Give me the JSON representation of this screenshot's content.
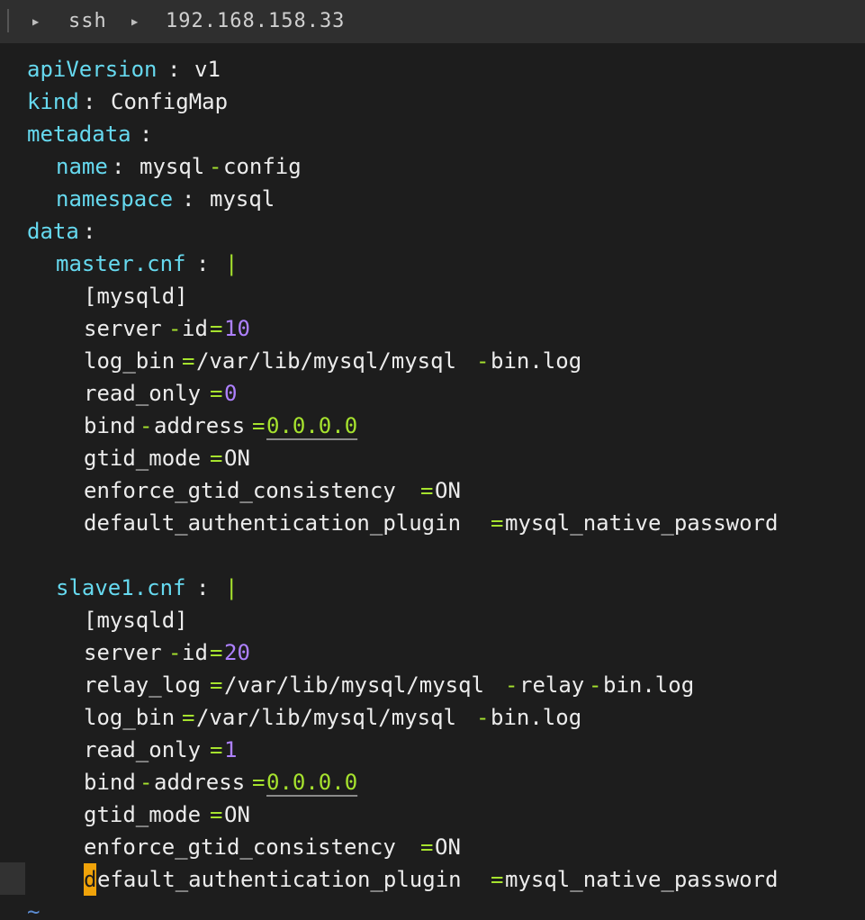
{
  "tabbar": {
    "segments": [
      "ssh",
      "192.168.158.33"
    ]
  },
  "editor": {
    "lines": {
      "l1_key": "apiVersion",
      "l1_sep": ": ",
      "l1_val": "v1",
      "l2_key": "kind",
      "l2_sep": ": ",
      "l2_val": "ConfigMap",
      "l3_key": "metadata",
      "l3_sep": ":",
      "l4_key": "name",
      "l4_sep": ": ",
      "l4_val_a": "mysql",
      "l4_dash": "-",
      "l4_val_b": "config",
      "l5_key": "namespace",
      "l5_sep": ": ",
      "l5_val": "mysql",
      "l6_key": "data",
      "l6_sep": ":",
      "l7_key": "master.cnf",
      "l7_sep": ": ",
      "l7_pipe": "|",
      "l8": "[mysqld]",
      "l9_a": "server",
      "l9_dash": "-",
      "l9_b": "id",
      "l9_eq": "=",
      "l9_num": "10",
      "l10_a": "log_bin",
      "l10_eq": "=",
      "l10_b": "/var/lib/mysql/mysql",
      "l10_dash": "-",
      "l10_c": "bin.log",
      "l11_a": "read_only",
      "l11_eq": "=",
      "l11_num": "0",
      "l12_a": "bind",
      "l12_dash": "-",
      "l12_b": "address",
      "l12_eq": "=",
      "l12_ip": "0.0.0.0",
      "l13_a": "gtid_mode",
      "l13_eq": "=",
      "l13_b": "ON",
      "l14_a": "enforce_gtid_consistency",
      "l14_eq": "=",
      "l14_b": "ON",
      "l15_a": "default_authentication_plugin",
      "l15_eq": "=",
      "l15_b": "mysql_native_password",
      "l17_key": "slave1.cnf",
      "l17_sep": ": ",
      "l17_pipe": "|",
      "l18": "[mysqld]",
      "l19_a": "server",
      "l19_dash": "-",
      "l19_b": "id",
      "l19_eq": "=",
      "l19_num": "20",
      "l20_a": "relay_log",
      "l20_eq": "=",
      "l20_b": "/var/lib/mysql/mysql",
      "l20_dash1": "-",
      "l20_c": "relay",
      "l20_dash2": "-",
      "l20_d": "bin.log",
      "l21_a": "log_bin",
      "l21_eq": "=",
      "l21_b": "/var/lib/mysql/mysql",
      "l21_dash": "-",
      "l21_c": "bin.log",
      "l22_a": "read_only",
      "l22_eq": "=",
      "l22_num": "1",
      "l23_a": "bind",
      "l23_dash": "-",
      "l23_b": "address",
      "l23_eq": "=",
      "l23_ip": "0.0.0.0",
      "l24_a": "gtid_mode",
      "l24_eq": "=",
      "l24_b": "ON",
      "l25_a": "enforce_gtid_consistency",
      "l25_eq": "=",
      "l25_b": "ON",
      "l26_cursor": "d",
      "l26_a": "efault_authentication_plugin",
      "l26_eq": "=",
      "l26_b": "mysql_native_password",
      "tilde": "~"
    }
  },
  "colors": {
    "background": "#1d1d1d",
    "tabbar": "#2f2f2f",
    "key": "#66d9ef",
    "operator": "#a6e22e",
    "number": "#ae81ff",
    "cursor": "#f0a30a"
  }
}
